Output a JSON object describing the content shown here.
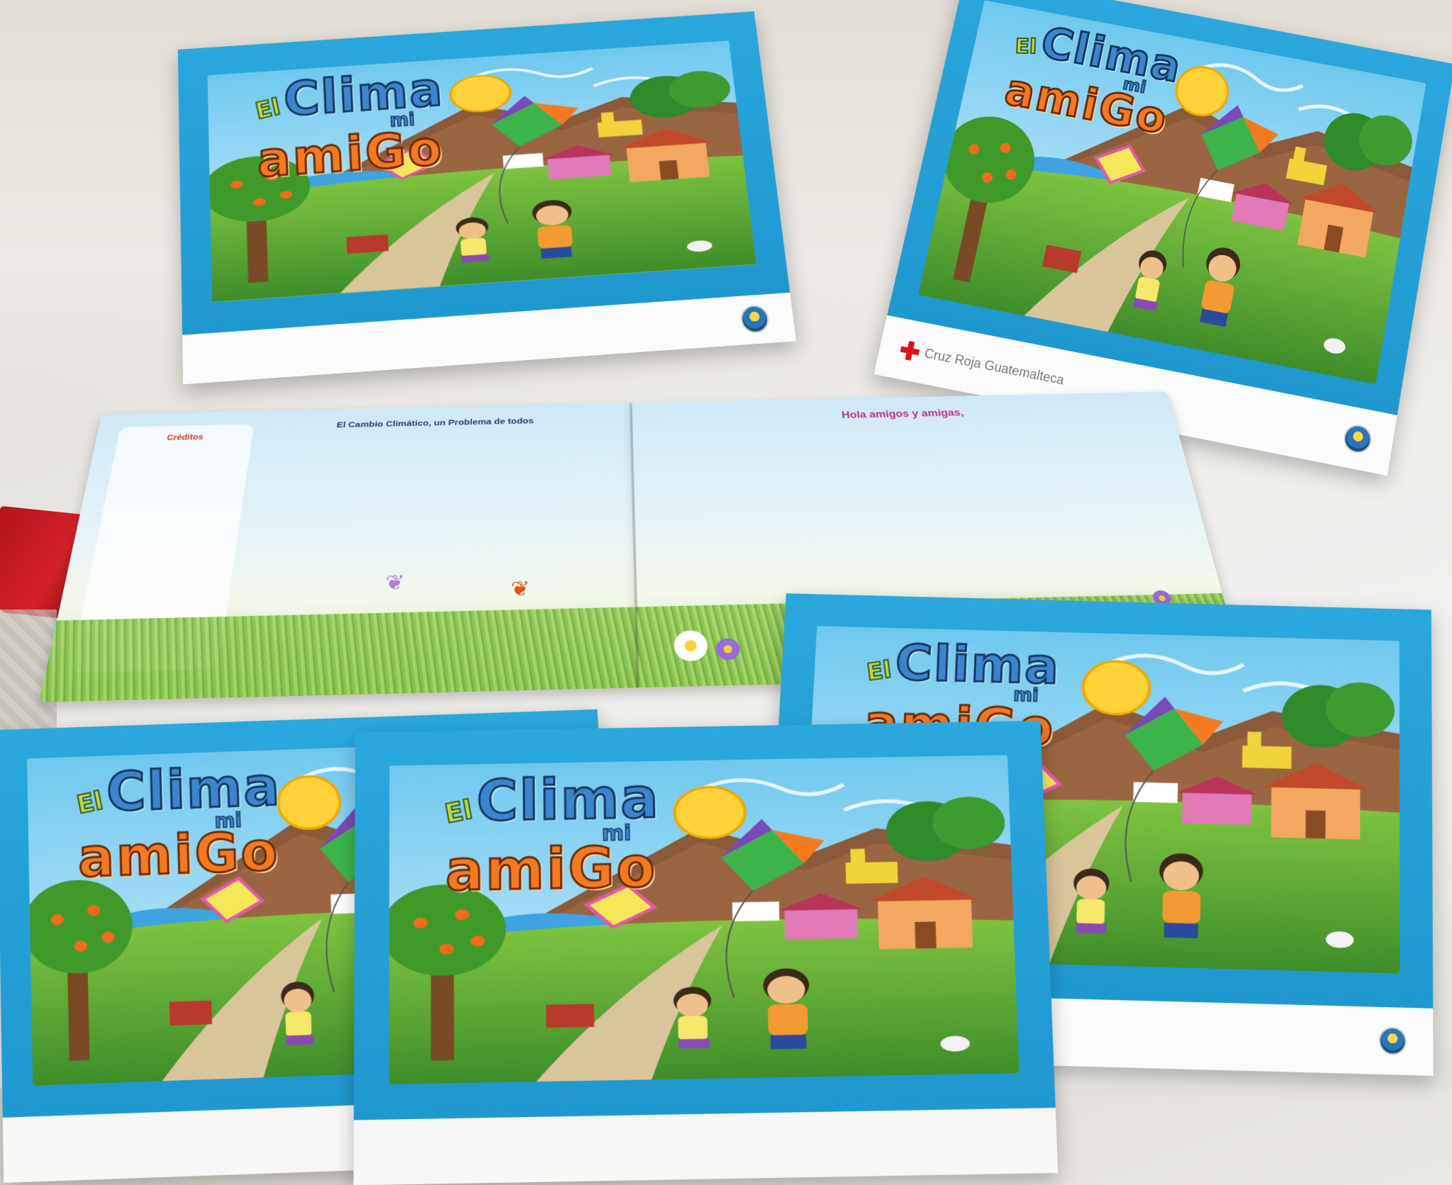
{
  "scene": {
    "description_colors": {
      "cover_blue": "#1f98d0",
      "title_blue": "#3c86d0",
      "title_orange": "#f47a22",
      "red_cross": "#d8141a"
    }
  },
  "cover": {
    "title_el": "El",
    "title_clima": "Clima",
    "title_mi": "mi",
    "title_amigo": "amiGo",
    "publisher": "Cruz Roja Guatemalteca",
    "publisher_icon": "red-cross-icon",
    "seal_icon": "seal-icon"
  },
  "booklet": {
    "left_panel_title": "Créditos",
    "left_panel_text": [],
    "left_heading": "El Cambio Climático, un Problema de todos",
    "left_paragraphs": [],
    "right_heading": "Hola amigos y amigas,",
    "right_paragraphs": []
  }
}
